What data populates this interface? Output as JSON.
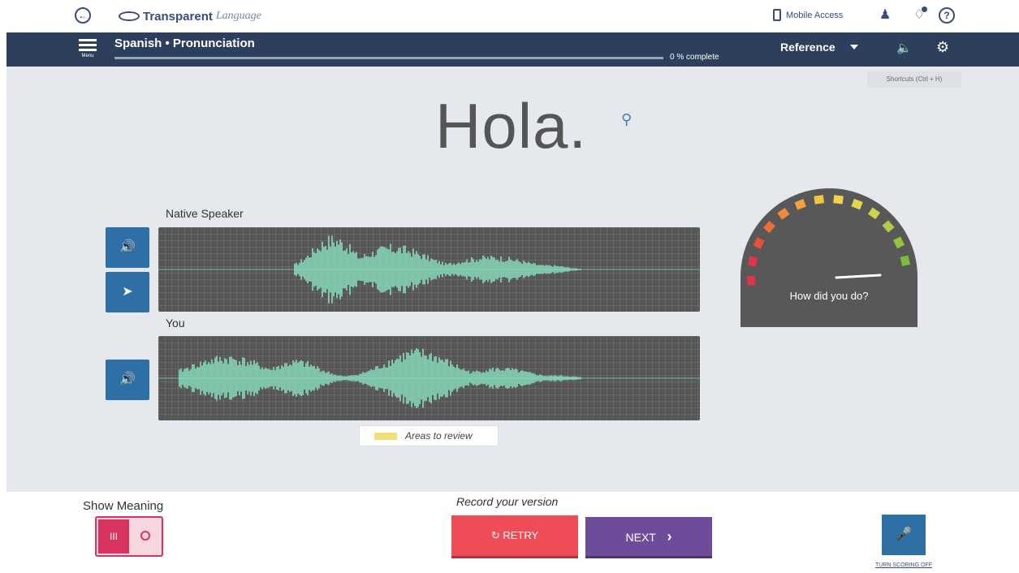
{
  "brand": {
    "name": "Transparent",
    "sub": "Language"
  },
  "header": {
    "mobile_access": "Mobile Access"
  },
  "navbar": {
    "menu_label": "Menu",
    "course_title": "Spanish • Pronunciation",
    "progress_text": "0 % complete",
    "progress_fraction": 0,
    "reference_label": "Reference"
  },
  "main": {
    "shortcuts": "Shortcuts (Ctrl + H)",
    "phrase": "Hola.",
    "native_label": "Native Speaker",
    "you_label": "You",
    "legend": "Areas to review"
  },
  "gauge": {
    "caption": "How did you do?",
    "segment_colors": [
      "#e0344a",
      "#e0344a",
      "#e65138",
      "#ec6e36",
      "#f08a3a",
      "#f4a23e",
      "#f6c444",
      "#f4d250",
      "#e6d44c",
      "#cfd24a",
      "#b4cc45",
      "#96c43e",
      "#7dbd37"
    ]
  },
  "bottom": {
    "show_meaning": "Show Meaning",
    "toggle_on_glyph": "III",
    "record_label": "Record your version",
    "retry_label": "RETRY",
    "next_label": "NEXT",
    "scoring_label": "TURN SCORING OFF"
  },
  "colors": {
    "nav": "#2e3f5e",
    "accent_blue": "#2e6fa6",
    "retry": "#ee4d58",
    "next": "#6d4d9b",
    "wave": "#8fefcb",
    "review": "#f5dd7a"
  }
}
